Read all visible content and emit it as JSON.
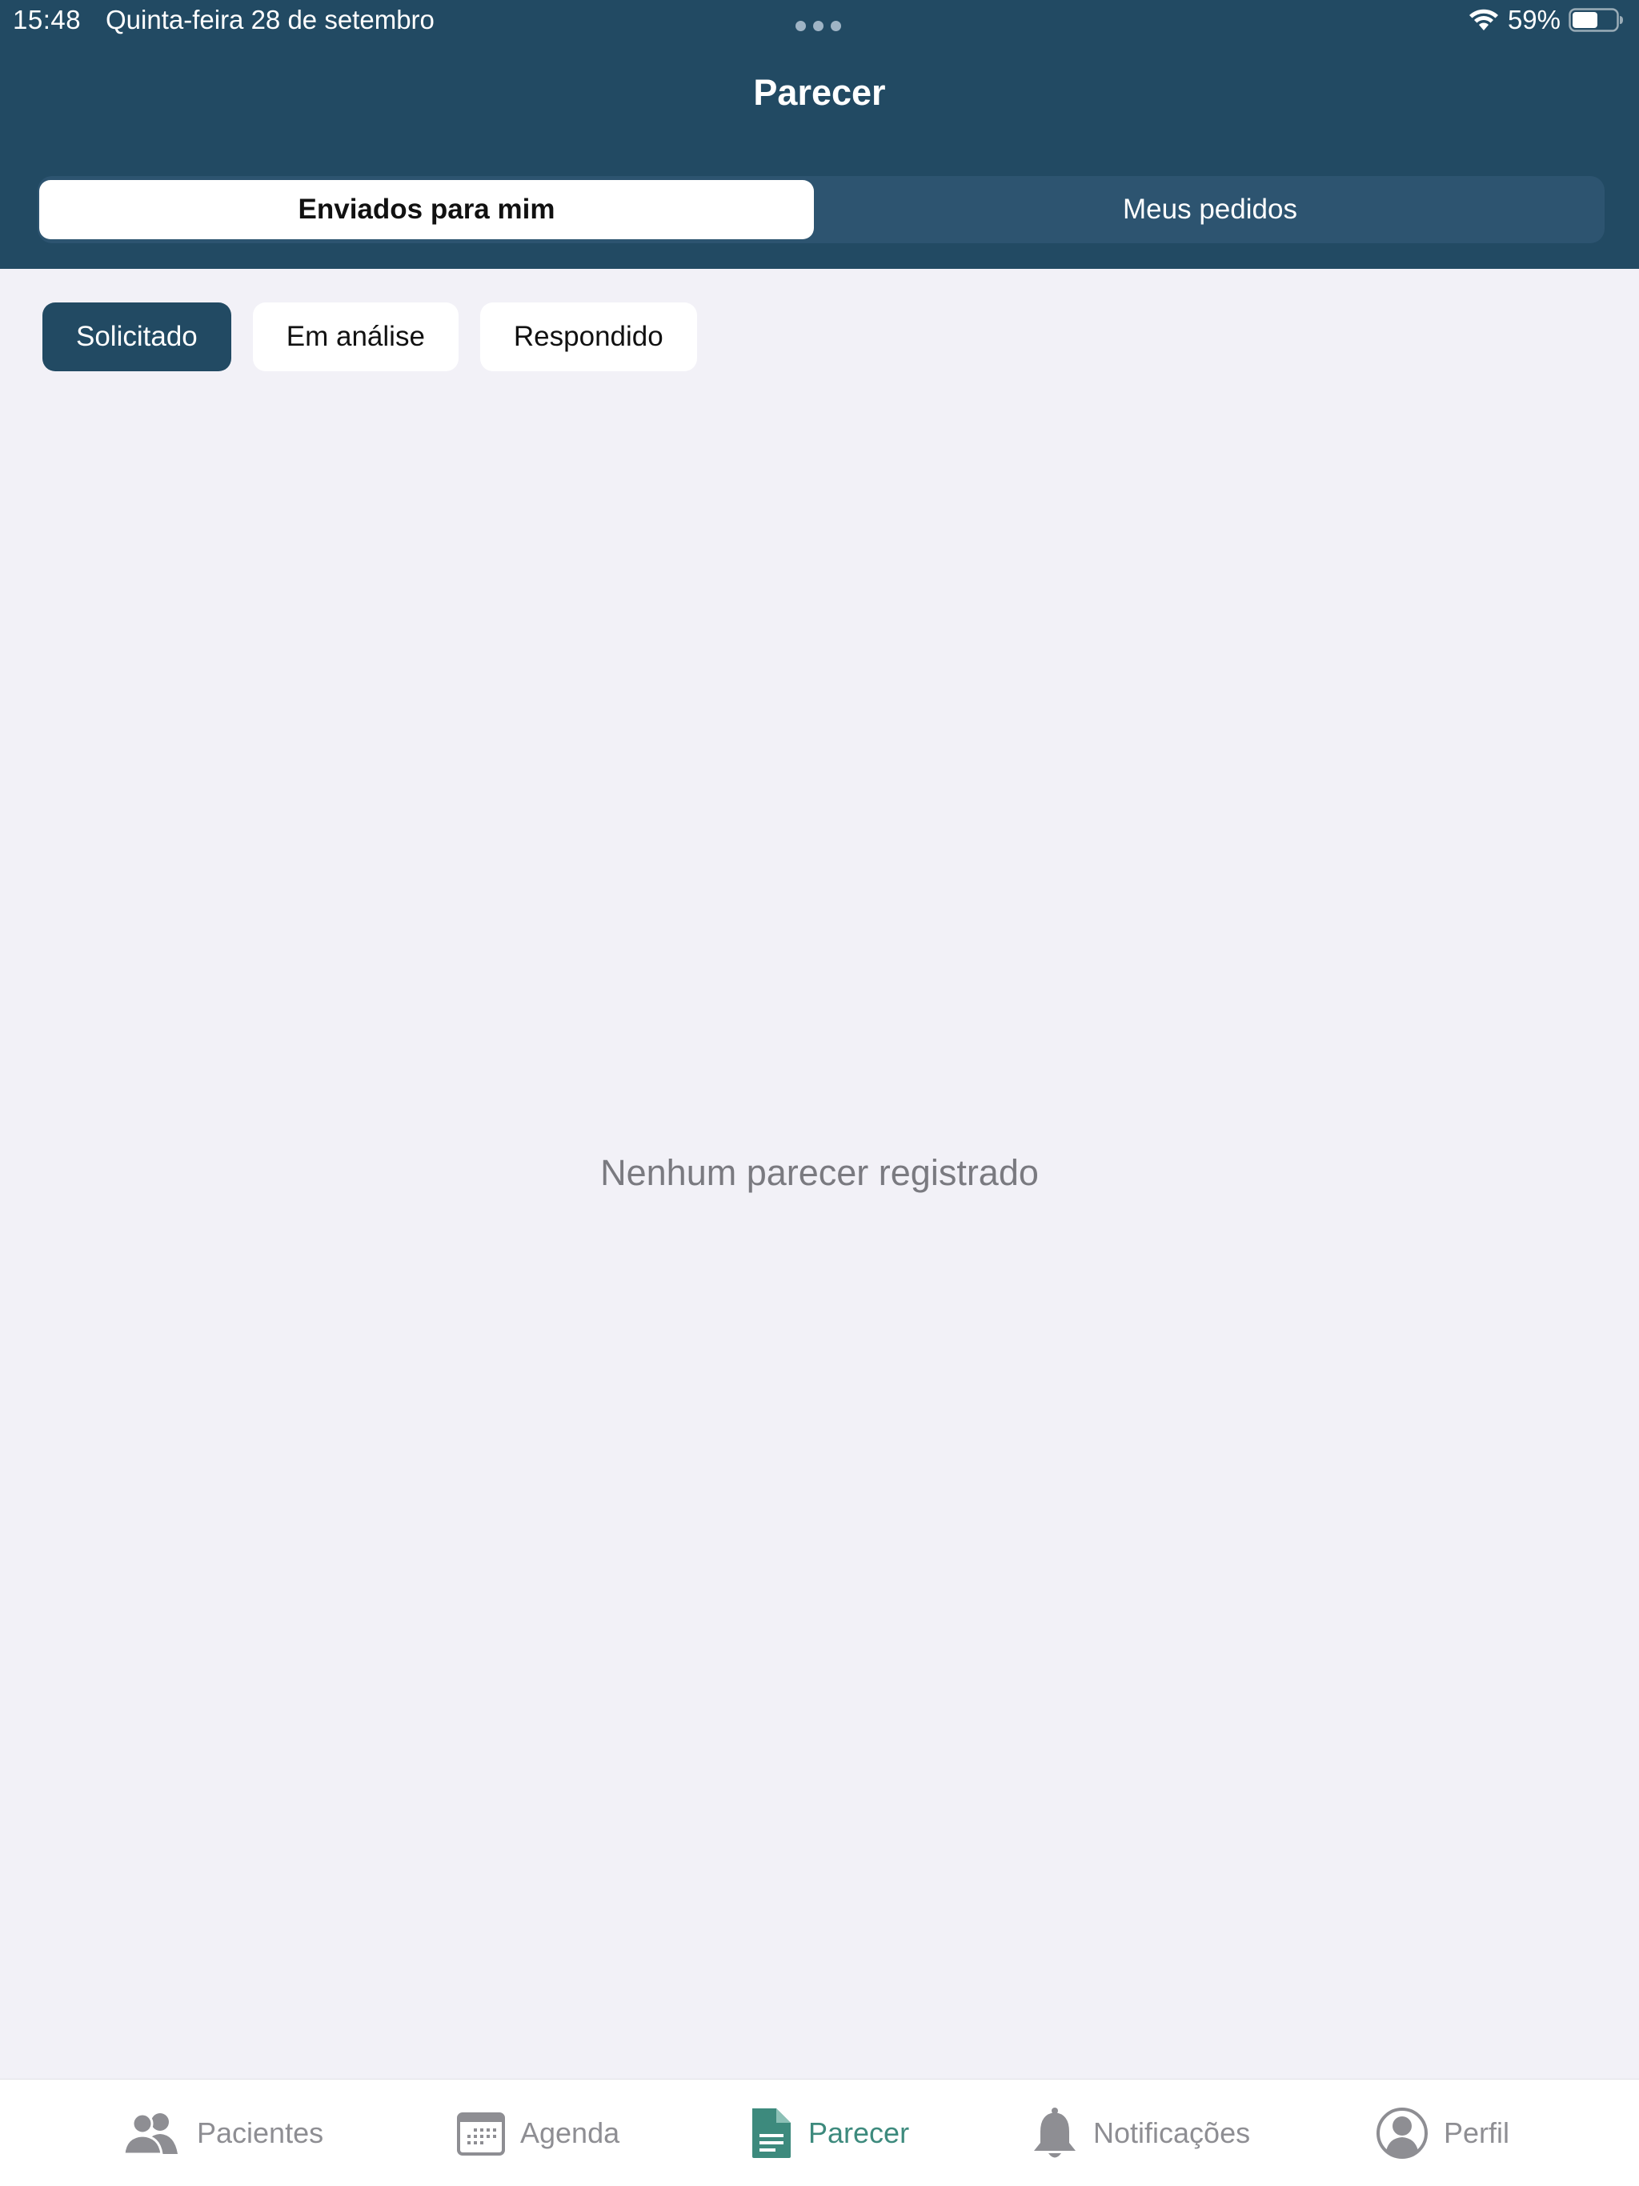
{
  "status_bar": {
    "time": "15:48",
    "date": "Quinta-feira 28 de setembro",
    "battery": "59%",
    "battery_level": 0.59
  },
  "header": {
    "title": "Parecer",
    "segments": {
      "selected_label": "Enviados para mim",
      "other_label": "Meus pedidos"
    }
  },
  "filters": {
    "items": [
      "Solicitado",
      "Em análise",
      "Respondido"
    ],
    "active": "Solicitado"
  },
  "main": {
    "empty_message": "Nenhum parecer registrado"
  },
  "tabbar": {
    "items": [
      {
        "label": "Pacientes",
        "icon": "people-icon"
      },
      {
        "label": "Agenda",
        "icon": "calendar-icon"
      },
      {
        "label": "Parecer",
        "icon": "document-icon"
      },
      {
        "label": "Notificações",
        "icon": "bell-icon"
      },
      {
        "label": "Perfil",
        "icon": "profile-icon"
      }
    ],
    "active": "Parecer"
  },
  "colors": {
    "header_bg": "#224a63",
    "accent": "#3d8a7d",
    "page_bg": "#f2f1f7"
  }
}
